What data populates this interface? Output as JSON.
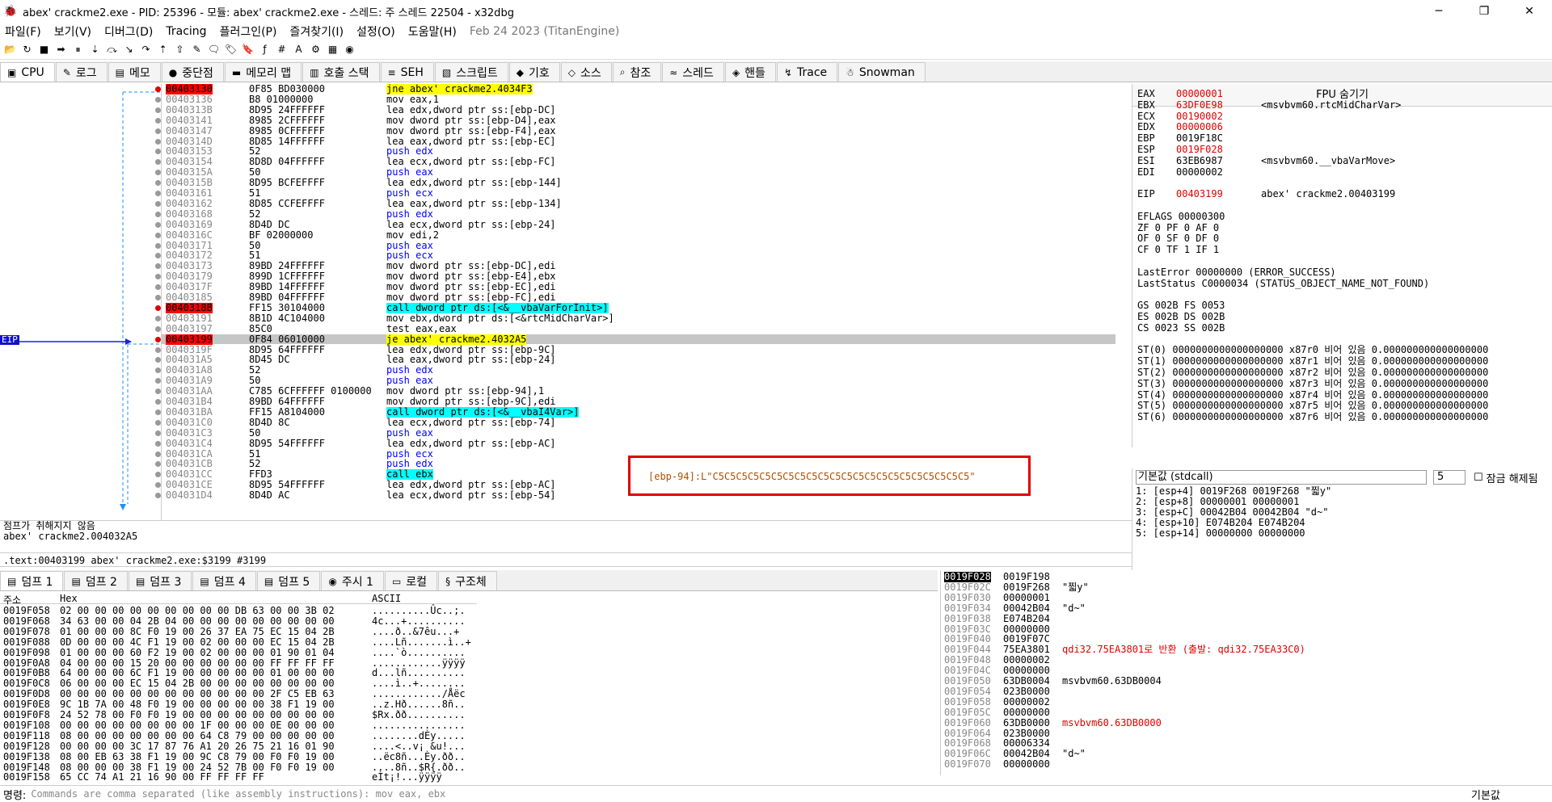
{
  "window": {
    "title": "abex' crackme2.exe - PID: 25396 - 모듈: abex' crackme2.exe - 스레드: 주 스레드 22504 - x32dbg"
  },
  "menu": [
    "파일(F)",
    "보기(V)",
    "디버그(D)",
    "Tracing",
    "플러그인(P)",
    "즐겨찾기(I)",
    "설정(O)",
    "도움말(H)"
  ],
  "menu_date": "Feb 24 2023 (TitanEngine)",
  "tabs": [
    {
      "label": "CPU",
      "icon": "cpu-icon"
    },
    {
      "label": "로그",
      "icon": "log-icon"
    },
    {
      "label": "메모",
      "icon": "notes-icon"
    },
    {
      "label": "중단점",
      "icon": "breakpoint-icon"
    },
    {
      "label": "메모리 맵",
      "icon": "memory-map-icon"
    },
    {
      "label": "호출 스택",
      "icon": "call-stack-icon"
    },
    {
      "label": "SEH",
      "icon": "seh-icon"
    },
    {
      "label": "스크립트",
      "icon": "script-icon"
    },
    {
      "label": "기호",
      "icon": "symbols-icon"
    },
    {
      "label": "소스",
      "icon": "source-icon"
    },
    {
      "label": "참조",
      "icon": "references-icon"
    },
    {
      "label": "스레드",
      "icon": "threads-icon"
    },
    {
      "label": "핸들",
      "icon": "handles-icon"
    },
    {
      "label": "Trace",
      "icon": "trace-icon"
    },
    {
      "label": "Snowman",
      "icon": "snowman-icon"
    }
  ],
  "eip_label": "EIP",
  "disasm": [
    {
      "addr": "00403130",
      "bytes": "0F85 BD030000",
      "instr": "jne abex' crackme2.4034F3",
      "bp": true,
      "kind": "jmp"
    },
    {
      "addr": "00403136",
      "bytes": "B8 01000000",
      "instr": "mov eax,1"
    },
    {
      "addr": "0040313B",
      "bytes": "8D95 24FFFFFF",
      "instr": "lea edx,dword ptr ss:[ebp-DC]"
    },
    {
      "addr": "00403141",
      "bytes": "8985 2CFFFFFF",
      "instr": "mov dword ptr ss:[ebp-D4],eax"
    },
    {
      "addr": "00403147",
      "bytes": "8985 0CFFFFFF",
      "instr": "mov dword ptr ss:[ebp-F4],eax"
    },
    {
      "addr": "0040314D",
      "bytes": "8D85 14FFFFFF",
      "instr": "lea eax,dword ptr ss:[ebp-EC]"
    },
    {
      "addr": "00403153",
      "bytes": "52",
      "instr": "push edx",
      "kind": "push"
    },
    {
      "addr": "00403154",
      "bytes": "8D8D 04FFFFFF",
      "instr": "lea ecx,dword ptr ss:[ebp-FC]"
    },
    {
      "addr": "0040315A",
      "bytes": "50",
      "instr": "push eax",
      "kind": "push"
    },
    {
      "addr": "0040315B",
      "bytes": "8D95 BCFEFFFF",
      "instr": "lea edx,dword ptr ss:[ebp-144]"
    },
    {
      "addr": "00403161",
      "bytes": "51",
      "instr": "push ecx",
      "kind": "push"
    },
    {
      "addr": "00403162",
      "bytes": "8D85 CCFEFFFF",
      "instr": "lea eax,dword ptr ss:[ebp-134]"
    },
    {
      "addr": "00403168",
      "bytes": "52",
      "instr": "push edx",
      "kind": "push"
    },
    {
      "addr": "00403169",
      "bytes": "8D4D DC",
      "instr": "lea ecx,dword ptr ss:[ebp-24]"
    },
    {
      "addr": "0040316C",
      "bytes": "BF 02000000",
      "instr": "mov edi,2"
    },
    {
      "addr": "00403171",
      "bytes": "50",
      "instr": "push eax",
      "kind": "push"
    },
    {
      "addr": "00403172",
      "bytes": "51",
      "instr": "push ecx",
      "kind": "push"
    },
    {
      "addr": "00403173",
      "bytes": "89BD 24FFFFFF",
      "instr": "mov dword ptr ss:[ebp-DC],edi"
    },
    {
      "addr": "00403179",
      "bytes": "899D 1CFFFFFF",
      "instr": "mov dword ptr ss:[ebp-E4],ebx"
    },
    {
      "addr": "0040317F",
      "bytes": "89BD 14FFFFFF",
      "instr": "mov dword ptr ss:[ebp-EC],edi"
    },
    {
      "addr": "00403185",
      "bytes": "89BD 04FFFFFF",
      "instr": "mov dword ptr ss:[ebp-FC],edi"
    },
    {
      "addr": "0040318B",
      "bytes": "FF15 30104000",
      "instr": "call dword ptr ds:[<&__vbaVarForInit>]",
      "bp": true,
      "kind": "call"
    },
    {
      "addr": "00403191",
      "bytes": "8B1D 4C104000",
      "instr": "mov ebx,dword ptr ds:[<&rtcMidCharVar>]"
    },
    {
      "addr": "00403197",
      "bytes": "85C0",
      "instr": "test eax,eax"
    },
    {
      "addr": "00403199",
      "bytes": "0F84 06010000",
      "instr": "je abex' crackme2.4032A5",
      "bp": true,
      "kind": "jmp",
      "cur": true
    },
    {
      "addr": "0040319F",
      "bytes": "8D95 64FFFFFF",
      "instr": "lea edx,dword ptr ss:[ebp-9C]"
    },
    {
      "addr": "004031A5",
      "bytes": "8D45 DC",
      "instr": "lea eax,dword ptr ss:[ebp-24]"
    },
    {
      "addr": "004031A8",
      "bytes": "52",
      "instr": "push edx",
      "kind": "push"
    },
    {
      "addr": "004031A9",
      "bytes": "50",
      "instr": "push eax",
      "kind": "push"
    },
    {
      "addr": "004031AA",
      "bytes": "C785 6CFFFFFF 0100000",
      "instr": "mov dword ptr ss:[ebp-94],1"
    },
    {
      "addr": "004031B4",
      "bytes": "89BD 64FFFFFF",
      "instr": "mov dword ptr ss:[ebp-9C],edi"
    },
    {
      "addr": "004031BA",
      "bytes": "FF15 A8104000",
      "instr": "call dword ptr ds:[<&__vbaI4Var>]",
      "kind": "call"
    },
    {
      "addr": "004031C0",
      "bytes": "8D4D 8C",
      "instr": "lea ecx,dword ptr ss:[ebp-74]"
    },
    {
      "addr": "004031C3",
      "bytes": "50",
      "instr": "push eax",
      "kind": "push"
    },
    {
      "addr": "004031C4",
      "bytes": "8D95 54FFFFFF",
      "instr": "lea edx,dword ptr ss:[ebp-AC]"
    },
    {
      "addr": "004031CA",
      "bytes": "51",
      "instr": "push ecx",
      "kind": "push"
    },
    {
      "addr": "004031CB",
      "bytes": "52",
      "instr": "push edx",
      "kind": "push"
    },
    {
      "addr": "004031CC",
      "bytes": "FFD3",
      "instr": "call ebx",
      "kind": "call"
    },
    {
      "addr": "004031CE",
      "bytes": "8D95 54FFFFFF",
      "instr": "lea edx,dword ptr ss:[ebp-AC]"
    },
    {
      "addr": "004031D4",
      "bytes": "8D4D AC",
      "instr": "lea ecx,dword ptr ss:[ebp-54]"
    }
  ],
  "highlight_comment": "[ebp-94]:L\"C5C5C5C5C5C5C5C5C5C5C5C5C5C5C5C5C5C5C5C5C5C5\"",
  "info": {
    "line1": "점프가 취해지지 않음",
    "line2": "abex' crackme2.004032A5"
  },
  "addr_line": ".text:00403199 abex' crackme2.exe:$3199 #3199",
  "regs": {
    "header": "FPU 숨기기",
    "items": [
      {
        "n": "EAX",
        "v": "00000001",
        "c": "",
        "red": true
      },
      {
        "n": "EBX",
        "v": "63DF0E98",
        "c": "<msvbvm60.rtcMidCharVar>",
        "red": true
      },
      {
        "n": "ECX",
        "v": "00190002",
        "c": "",
        "red": true
      },
      {
        "n": "EDX",
        "v": "00000006",
        "c": "",
        "red": true
      },
      {
        "n": "EBP",
        "v": "0019F18C",
        "c": ""
      },
      {
        "n": "ESP",
        "v": "0019F028",
        "c": "",
        "red": true
      },
      {
        "n": "ESI",
        "v": "63EB6987",
        "c": "<msvbvm60.__vbaVarMove>"
      },
      {
        "n": "EDI",
        "v": "00000002",
        "c": ""
      },
      {
        "n": "",
        "v": "",
        "c": ""
      },
      {
        "n": "EIP",
        "v": "00403199",
        "c": "abex' crackme2.00403199",
        "red": true
      }
    ],
    "eflags": "EFLAGS   00000300",
    "flags": [
      "ZF 0  PF 0  AF 0",
      "OF 0  SF 0  DF 0",
      "CF 0  TF 1  IF 1"
    ],
    "lasterror": "LastError  00000000 (ERROR_SUCCESS)",
    "laststatus": "LastStatus C0000034 (STATUS_OBJECT_NAME_NOT_FOUND)",
    "seg": [
      "GS 002B  FS 0053",
      "ES 002B  DS 002B",
      "CS 0023  SS 002B"
    ],
    "st": [
      "ST(0) 0000000000000000000 x87r0 비어 있음 0.000000000000000000",
      "ST(1) 0000000000000000000 x87r1 비어 있음 0.000000000000000000",
      "ST(2) 0000000000000000000 x87r2 비어 있음 0.000000000000000000",
      "ST(3) 0000000000000000000 x87r3 비어 있음 0.000000000000000000",
      "ST(4) 0000000000000000000 x87r4 비어 있음 0.000000000000000000",
      "ST(5) 0000000000000000000 x87r5 비어 있음 0.000000000000000000",
      "ST(6) 0000000000000000000 x87r6 비어 있음 0.000000000000000000"
    ]
  },
  "callconv": {
    "select": "기본값 (stdcall)",
    "count": "5",
    "lock": "잠금 해제됨",
    "lines": [
      "1: [esp+4] 0019F268 0019F268 \"찗y\"",
      "2: [esp+8] 00000001 00000001",
      "3: [esp+C] 00042B04 00042B04 \"d~\"",
      "4: [esp+10] E074B204 E074B204",
      "5: [esp+14] 00000000 00000000"
    ]
  },
  "dump_tabs": [
    {
      "label": "덤프 1",
      "icon": "dump-icon"
    },
    {
      "label": "덤프 2",
      "icon": "dump-icon"
    },
    {
      "label": "덤프 3",
      "icon": "dump-icon"
    },
    {
      "label": "덤프 4",
      "icon": "dump-icon"
    },
    {
      "label": "덤프 5",
      "icon": "dump-icon"
    },
    {
      "label": "주시 1",
      "icon": "watch-icon"
    },
    {
      "label": "로컬",
      "icon": "locals-icon"
    },
    {
      "label": "구조체",
      "icon": "struct-icon"
    }
  ],
  "dump_headers": {
    "addr": "주소",
    "hex": "Hex",
    "ascii": "ASCII"
  },
  "dump": [
    {
      "a": "0019F058",
      "h": "02 00 00 00 00 00 00 00 00 00 DB 63 00 00 3B 02",
      "s": "..........Ûc..;."
    },
    {
      "a": "0019F068",
      "h": "34 63 00 00 04 2B 04 00 00 00 00 00 00 00 00 00",
      "s": "4c...+.........."
    },
    {
      "a": "0019F078",
      "h": "01 00 00 00 8C F0 19 00 26 37 EA 75 EC 15 04 2B",
      "s": "....ð..&7êu...+"
    },
    {
      "a": "0019F088",
      "h": "0D 00 00 00 4C F1 19 00 02 00 00 00 EC 15 04 2B",
      "s": "....Lñ.......ì..+"
    },
    {
      "a": "0019F098",
      "h": "01 00 00 00 60 F2 19 00 02 00 00 00 01 90 01 04",
      "s": "....`ò.........."
    },
    {
      "a": "0019F0A8",
      "h": "04 00 00 00 15 20 00 00 00 00 00 00 FF FF FF FF",
      "s": "............ÿÿÿÿ"
    },
    {
      "a": "0019F0B8",
      "h": "64 00 00 00 6C F1 19 00 00 00 00 00 01 00 00 00",
      "s": "d...lñ.........."
    },
    {
      "a": "0019F0C8",
      "h": "06 00 00 00 EC 15 04 2B 00 00 00 00 00 00 00 00",
      "s": "....ì..+........"
    },
    {
      "a": "0019F0D8",
      "h": "00 00 00 00 00 00 00 00 00 00 00 00 2F C5 EB 63",
      "s": "............/Åëc"
    },
    {
      "a": "0019F0E8",
      "h": "9C 1B 7A 00 48 F0 19 00 00 00 00 00 38 F1 19 00",
      "s": "..z.Hð......8ñ.."
    },
    {
      "a": "0019F0F8",
      "h": "24 52 78 00 F0 F0 19 00 00 00 00 00 00 00 00 00",
      "s": "$Rx.ðð.........."
    },
    {
      "a": "0019F108",
      "h": "00 00 00 00 00 00 00 00 1F 00 00 00 0E 00 00 00",
      "s": "................"
    },
    {
      "a": "0019F118",
      "h": "08 00 00 00 00 00 00 00 64 C8 79 00 00 00 00 00",
      "s": "........dÈy....."
    },
    {
      "a": "0019F128",
      "h": "00 00 00 00 3C 17 87 76 A1 20 26 75 21 16 01 90",
      "s": "....<..v¡ &u!..."
    },
    {
      "a": "0019F138",
      "h": "08 00 EB 63 38 F1 19 00 9C C8 79 00 F0 F0 19 00",
      "s": "..ëc8ñ...Èy.ðð.."
    },
    {
      "a": "0019F148",
      "h": "08 00 00 00 38 F1 19 00 24 52 7B 00 F0 F0 19 00",
      "s": "....8ñ..$R{.ðð.."
    },
    {
      "a": "0019F158",
      "h": "65 CC 74 A1 21 16 90 00 FF FF FF FF",
      "s": "eÌt¡!...ÿÿÿÿ"
    }
  ],
  "stack": [
    {
      "a": "0019F028",
      "v": "0019F198",
      "c": "",
      "top": true
    },
    {
      "a": "0019F02C",
      "v": "0019F268",
      "c": "\"찗y\""
    },
    {
      "a": "0019F030",
      "v": "00000001",
      "c": ""
    },
    {
      "a": "0019F034",
      "v": "00042B04",
      "c": "\"d~\""
    },
    {
      "a": "0019F038",
      "v": "E074B204",
      "c": ""
    },
    {
      "a": "0019F03C",
      "v": "00000000",
      "c": ""
    },
    {
      "a": "0019F040",
      "v": "0019F07C",
      "c": ""
    },
    {
      "a": "0019F044",
      "v": "75EA3801",
      "c": "qdi32.75EA3801로 반환 (출발: qdi32.75EA33C0)",
      "red": true
    },
    {
      "a": "0019F048",
      "v": "00000002",
      "c": ""
    },
    {
      "a": "0019F04C",
      "v": "00000000",
      "c": ""
    },
    {
      "a": "0019F050",
      "v": "63DB0004",
      "c": "msvbvm60.63DB0004"
    },
    {
      "a": "0019F054",
      "v": "023B0000",
      "c": ""
    },
    {
      "a": "0019F058",
      "v": "00000002",
      "c": ""
    },
    {
      "a": "0019F05C",
      "v": "00000000",
      "c": ""
    },
    {
      "a": "0019F060",
      "v": "63DB0000",
      "c": "msvbvm60.63DB0000",
      "red": true
    },
    {
      "a": "0019F064",
      "v": "023B0000",
      "c": ""
    },
    {
      "a": "0019F068",
      "v": "00006334",
      "c": ""
    },
    {
      "a": "0019F06C",
      "v": "00042B04",
      "c": "\"d~\""
    },
    {
      "a": "0019F070",
      "v": "00000000",
      "c": ""
    }
  ],
  "cmd": {
    "label": "명령:",
    "placeholder": "Commands are comma separated (like assembly instructions): mov eax, ebx",
    "default": "기본값"
  }
}
